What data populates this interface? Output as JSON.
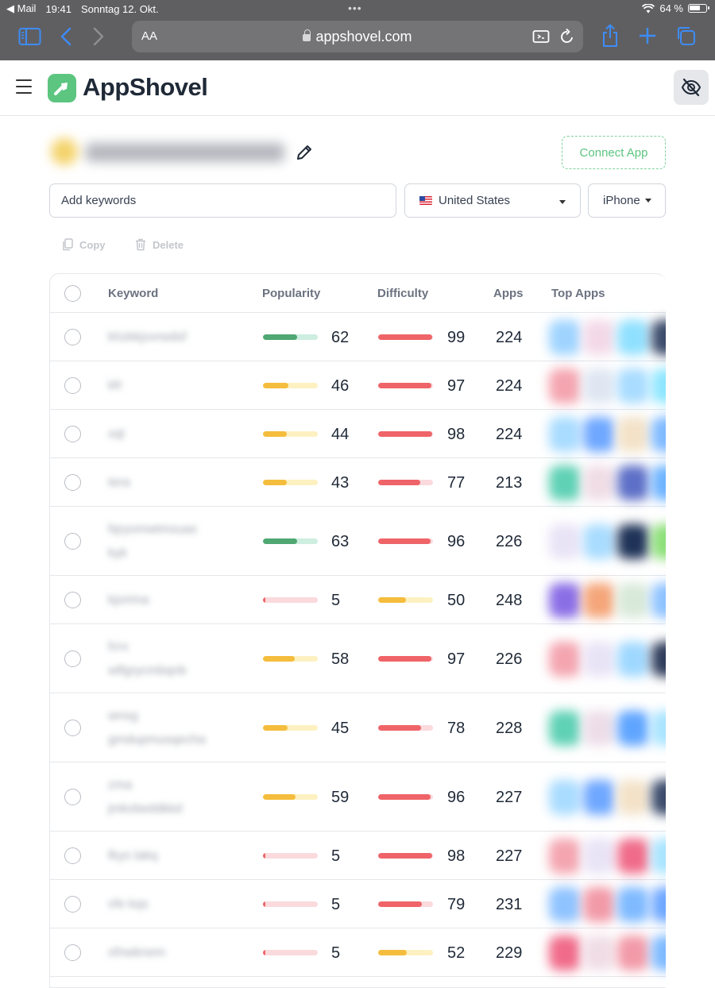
{
  "status": {
    "back_app": "Mail",
    "time": "19:41",
    "date": "Sonntag 12. Okt.",
    "battery": "64 %"
  },
  "browser": {
    "aa_label": "AA",
    "host": "appshovel.com"
  },
  "app": {
    "brand": "AppShovel"
  },
  "project": {
    "connect_label": "Connect App"
  },
  "filters": {
    "keyword_placeholder": "Add keywords",
    "country": "United States",
    "device": "iPhone"
  },
  "actions": {
    "copy": "Copy",
    "delete": "Delete"
  },
  "table": {
    "headers": {
      "keyword": "Keyword",
      "popularity": "Popularity",
      "difficulty": "Difficulty",
      "apps": "Apps",
      "top_apps": "Top Apps"
    },
    "rows": [
      {
        "keyword": [
          "khzkkjvvrwdsf"
        ],
        "popularity": 62,
        "difficulty": 99,
        "apps": "224",
        "top": [
          "#9fd4ff",
          "#f3d9e8",
          "#8fe0ff",
          "#3b4b6b"
        ]
      },
      {
        "keyword": [
          "kfr"
        ],
        "popularity": 46,
        "difficulty": 97,
        "apps": "224",
        "top": [
          "#f4a5b0",
          "#dfe6f2",
          "#a9dcff",
          "#8fe6ff"
        ]
      },
      {
        "keyword": [
          "xql"
        ],
        "popularity": 44,
        "difficulty": 98,
        "apps": "224",
        "top": [
          "#a9dcff",
          "#6fa8ff",
          "#f3e2c8",
          "#7fbaff"
        ]
      },
      {
        "keyword": [
          "tera"
        ],
        "popularity": 43,
        "difficulty": 77,
        "apps": "213",
        "top": [
          "#5fd1b5",
          "#f0dde6",
          "#5d6fc7",
          "#6fb4ff"
        ]
      },
      {
        "keyword": [
          "fqryomwtmsuas",
          "kyk"
        ],
        "popularity": 63,
        "difficulty": 96,
        "apps": "226",
        "top": [
          "#e9e3f6",
          "#a9dcff",
          "#1f3358",
          "#8ee07a"
        ]
      },
      {
        "keyword": [
          "kjorima"
        ],
        "popularity": 5,
        "difficulty": 50,
        "apps": "248",
        "top": [
          "#8a6ee6",
          "#f5a67a",
          "#d8e9d9",
          "#8fc3ff"
        ]
      },
      {
        "keyword": [
          "fcrx",
          "wlfgrycmbqnb"
        ],
        "popularity": 58,
        "difficulty": 97,
        "apps": "226",
        "top": [
          "#f4a5b0",
          "#e9e3f6",
          "#9fd8ff",
          "#2f3d5c"
        ]
      },
      {
        "keyword": [
          "wnxg",
          "gmdupmusqecha"
        ],
        "popularity": 45,
        "difficulty": 78,
        "apps": "228",
        "top": [
          "#5fd1b5",
          "#eddde8",
          "#5fa5ff",
          "#a9e4ff"
        ]
      },
      {
        "keyword": [
          "zma",
          "jmkxbeddkkd"
        ],
        "popularity": 59,
        "difficulty": 96,
        "apps": "227",
        "top": [
          "#a9dcff",
          "#6fa8ff",
          "#f3e2c8",
          "#3b4b6b"
        ]
      },
      {
        "keyword": [
          "fkys lakq"
        ],
        "popularity": 5,
        "difficulty": 98,
        "apps": "227",
        "top": [
          "#f4a5b0",
          "#e9e3f6",
          "#f06b8a",
          "#a9e4ff"
        ]
      },
      {
        "keyword": [
          "vfe kqs"
        ],
        "popularity": 5,
        "difficulty": 79,
        "apps": "231",
        "top": [
          "#8fc3ff",
          "#f29aa8",
          "#7fbaff",
          "#6fa8ff"
        ]
      },
      {
        "keyword": [
          "xfnwknem"
        ],
        "popularity": 5,
        "difficulty": 52,
        "apps": "229",
        "top": [
          "#f06b8a",
          "#f0dde6",
          "#f29aa8",
          "#7fbaff"
        ]
      }
    ]
  },
  "colors": {
    "accent": "#5cc57f",
    "green": "#4fa772",
    "green_track": "#cdeee0",
    "yellow": "#f5bd3d",
    "yellow_track": "#fdf1c2",
    "red": "#ef6468",
    "red_track": "#fadadd"
  }
}
